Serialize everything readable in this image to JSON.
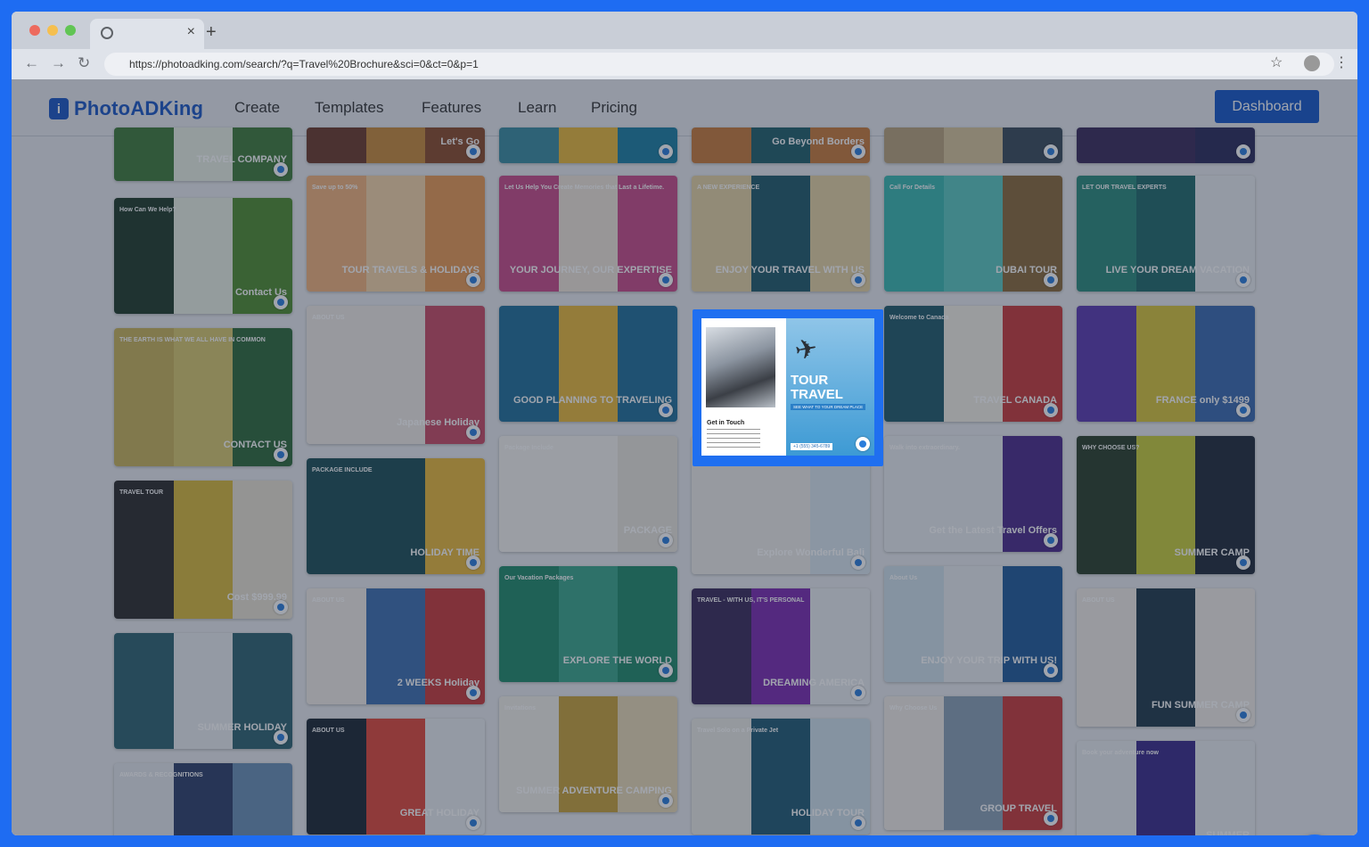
{
  "browser": {
    "url": "https://photoadking.com/search/?q=Travel%20Brochure&sci=0&ct=0&p=1",
    "tab_close": "×",
    "new_tab": "+",
    "back": "←",
    "forward": "→",
    "reload": "↻",
    "star": "☆",
    "menu": "⋮"
  },
  "site": {
    "logo_mark": "i",
    "logo_text": "PhotoADKing",
    "nav": [
      "Create",
      "Templates",
      "Features",
      "Learn",
      "Pricing"
    ],
    "dashboard_label": "Dashboard"
  },
  "highlighted_template": {
    "title_line1": "TOUR",
    "title_line2": "TRAVEL",
    "tagline": "SEE WHAT TO YOUR DREAM PLACE",
    "contact_heading": "Get in Touch",
    "phone": "+1 (555) 345-6789"
  },
  "cards": [
    {
      "a": "#3f7a3a",
      "b": "#e9efe4",
      "c": "#3f7a3a",
      "t": "",
      "big": "TRAVEL COMPANY"
    },
    {
      "a": "#1f3b2a",
      "b": "#e9efe4",
      "c": "#4f8c2f",
      "t": "How Can We Help?",
      "big": "Contact Us"
    },
    {
      "a": "#c9b45a",
      "b": "#d8c86d",
      "c": "#2d6a3a",
      "t": "THE EARTH IS WHAT WE ALL HAVE IN COMMON",
      "big": "CONTACT US"
    },
    {
      "a": "#2b2b2b",
      "b": "#d8b83a",
      "c": "#e8e2d2",
      "t": "TRAVEL TOUR",
      "big": "Cost $999.99"
    },
    {
      "a": "#2d6370",
      "b": "#e9ecef",
      "c": "#2d6370",
      "t": "",
      "big": "SUMMER HOLIDAY"
    },
    {
      "a": "#e4e7ec",
      "b": "#2e3f6a",
      "c": "#6a8fb5",
      "t": "AWARDS & RECOGNITIONS",
      "big": ""
    },
    {
      "a": "#6b3a2a",
      "b": "#c98a3a",
      "c": "#8a4a2a",
      "t": "",
      "big": "Let's Go"
    },
    {
      "a": "#f1b27a",
      "b": "#f4d5a8",
      "c": "#e89a54",
      "t": "Save up to 50%",
      "big": "TOUR TRAVELS & HOLIDAYS"
    },
    {
      "a": "#f0ebe6",
      "b": "#f0ebe6",
      "c": "#c84a64",
      "t": "ABOUT US",
      "big": "Japanese Holiday"
    },
    {
      "a": "#1c4f57",
      "b": "#1c4f57",
      "c": "#e9b83a",
      "t": "PACKAGE INCLUDE",
      "big": "HOLIDAY TIME"
    },
    {
      "a": "#f1ede7",
      "b": "#3d6fb0",
      "c": "#c83a3a",
      "t": "ABOUT US",
      "big": "2 WEEKS Holiday"
    },
    {
      "a": "#1a2733",
      "b": "#e0473a",
      "c": "#e9ecef",
      "t": "ABOUT US",
      "big": "GREAT HOLIDAY"
    },
    {
      "a": "#3a8ca0",
      "b": "#e9b83a",
      "c": "#1a7fa3",
      "t": "",
      "big": ""
    },
    {
      "a": "#c84a88",
      "b": "#efe6d9",
      "c": "#c84a88",
      "t": "Let Us Help You Create Memories that Last a Lifetime.",
      "big": "YOUR JOURNEY, OUR EXPERTISE"
    },
    {
      "a": "#1f6f9a",
      "b": "#e9b83a",
      "c": "#1f6f9a",
      "t": "",
      "big": "GOOD PLANNING TO TRAVELING"
    },
    {
      "a": "#f5f3ef",
      "b": "#f5f3ef",
      "c": "#e9e5dd",
      "t": "Package Include",
      "big": "PACKAGE"
    },
    {
      "a": "#1f8a6a",
      "b": "#3aa58a",
      "c": "#1f8a6a",
      "t": "Our Vacation Packages",
      "big": "EXPLORE THE WORLD"
    },
    {
      "a": "#f2efe8",
      "b": "#c9a23a",
      "c": "#e9d9b5",
      "t": "Invitations",
      "big": "SUMMER ADVENTURE CAMPING"
    },
    {
      "a": "#c97a3a",
      "b": "#1f5f6a",
      "c": "#c97a3a",
      "t": "",
      "big": "Go Beyond Borders"
    },
    {
      "a": "#e5d2a2",
      "b": "#1f5a6a",
      "c": "#e5d2a2",
      "t": "A NEW EXPERIENCE",
      "big": "ENJOY YOUR TRAVEL WITH US"
    },
    {
      "a": "#eeece8",
      "b": "#eeece8",
      "c": "#d9e6ee",
      "t": "",
      "big": "Explore Wonderful Bali"
    },
    {
      "a": "#3a2a5a",
      "b": "#7a2ab0",
      "c": "#e9ecef",
      "t": "TRAVEL - WITH US, IT'S PERSONAL",
      "big": "DREAMING AMERICA"
    },
    {
      "a": "#eaebe6",
      "b": "#1f5a74",
      "c": "#cfe0ea",
      "t": "Travel Solo on a Private Jet",
      "big": "HOLIDAY TOUR"
    },
    {
      "a": "#b8a37a",
      "b": "#d8c49a",
      "c": "#3a4a5a",
      "t": "",
      "big": ""
    },
    {
      "a": "#3ab8b0",
      "b": "#5ac8c0",
      "c": "#8a6a3a",
      "t": "Call For Details",
      "big": "DUBAI TOUR"
    },
    {
      "a": "#1f5a6a",
      "b": "#f3efe6",
      "c": "#c83a3a",
      "t": "Welcome to Canada",
      "big": "TRAVEL CANADA"
    },
    {
      "a": "#e9ecef",
      "b": "#e9ecef",
      "c": "#4a2a8a",
      "t": "Walk into extraordinary.",
      "big": "Get the Latest Travel Offers"
    },
    {
      "a": "#cfe0ea",
      "b": "#e9ecef",
      "c": "#1f5a9a",
      "t": "About Us",
      "big": "ENJOY YOUR TRIP WITH US!"
    },
    {
      "a": "#f1ede7",
      "b": "#8aa0b5",
      "c": "#c83a3a",
      "t": "Why Choose Us",
      "big": "GROUP TRAVEL"
    },
    {
      "a": "#3a2a5a",
      "b": "#3a2a5a",
      "c": "#2a2a5a",
      "t": "",
      "big": ""
    },
    {
      "a": "#2a8a7a",
      "b": "#1f6a6a",
      "c": "#e9ecef",
      "t": "LET OUR TRAVEL EXPERTS",
      "big": "LIVE YOUR DREAM VACATION"
    },
    {
      "a": "#5a3ab0",
      "b": "#d8c43a",
      "c": "#3a6ab0",
      "t": "",
      "big": "FRANCE only $1499"
    },
    {
      "a": "#2a3f2a",
      "b": "#c8cd3a",
      "c": "#1f2a3a",
      "t": "WHY CHOOSE US?",
      "big": "SUMMER CAMP"
    },
    {
      "a": "#f1ede7",
      "b": "#1f3a4a",
      "c": "#f1ede7",
      "t": "ABOUT US",
      "big": "FUN SUMMER CAMP"
    },
    {
      "a": "#e9ecef",
      "b": "#3a2a8a",
      "c": "#e9ecef",
      "t": "Book your adventure now",
      "big": "SUMMER"
    }
  ]
}
